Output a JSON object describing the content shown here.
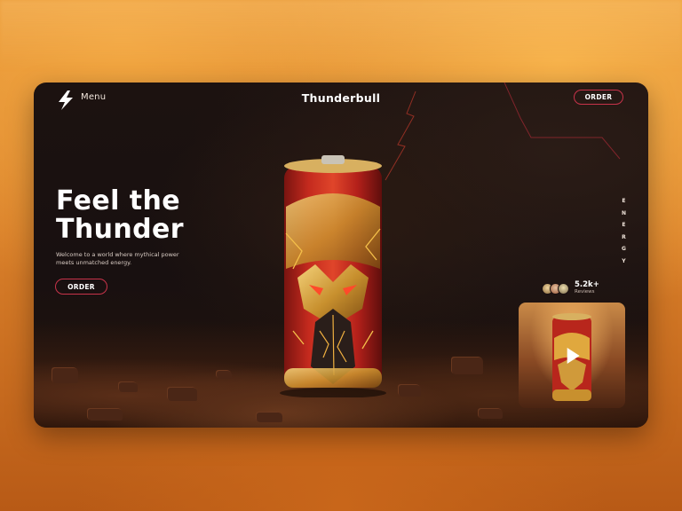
{
  "header": {
    "menu_label": "Menu",
    "brand": "Thunderbull",
    "order_label": "ORDER"
  },
  "hero": {
    "title_line1": "Feel the",
    "title_line2": "Thunder",
    "subtitle_line1": "Welcome to a world where mythical power",
    "subtitle_line2": "meets unmatched energy.",
    "order_label": "ORDER"
  },
  "side_text": [
    "E",
    "N",
    "E",
    "R",
    "G",
    "Y"
  ],
  "reviews": {
    "count": "5.2k+",
    "label": "Reviews"
  },
  "icons": {
    "logo": "lightning-bolt-icon",
    "play": "play-icon"
  },
  "colors": {
    "accent": "#c8334a",
    "background_orange": "#e7983a",
    "card_dark": "#1c1210",
    "can_gold": "#d9a441",
    "can_red": "#b8221c"
  }
}
